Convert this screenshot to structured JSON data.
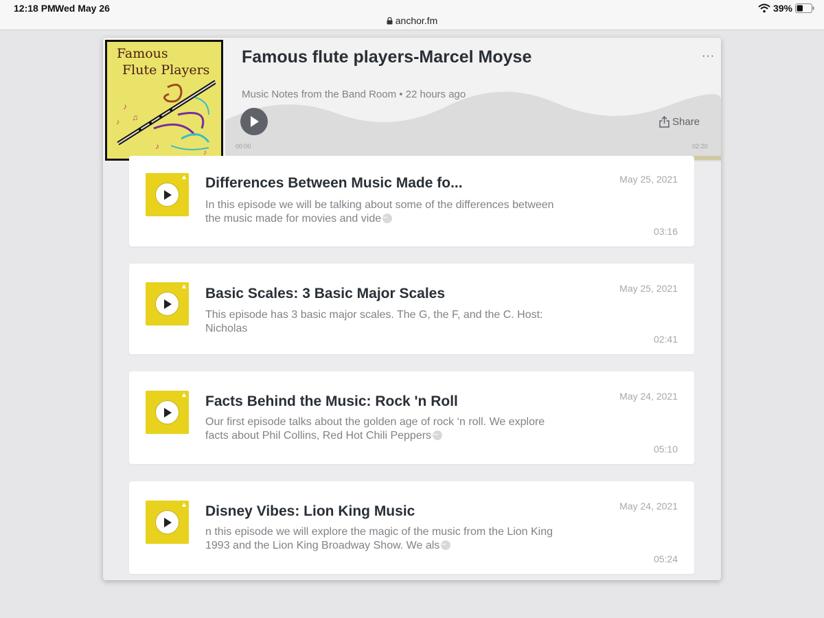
{
  "status": {
    "time": "12:18 PM",
    "date": "Wed May 26",
    "url": "anchor.fm",
    "battery": "39%"
  },
  "player": {
    "cover_line1": "Famous",
    "cover_line2": "Flute Players",
    "title": "Famous flute players-Marcel Moyse",
    "more": "···",
    "podcast_meta": "Music Notes from the Band Room • 22 hours ago",
    "share_label": "Share",
    "time_start": "00:00",
    "time_end": "02:20",
    "progress": 0
  },
  "episodes": [
    {
      "title": "Differences Between Music Made fo...",
      "description": "In this episode we will be talking about some of the differences between the music made for movies and vide",
      "truncated": true,
      "date": "May 25, 2021",
      "duration": "03:16"
    },
    {
      "title": "Basic Scales: 3 Basic Major Scales",
      "description": "This episode has 3 basic major scales. The G, the F, and the C.  Host: Nicholas",
      "truncated": false,
      "date": "May 25, 2021",
      "duration": "02:41"
    },
    {
      "title": "Facts Behind the Music: Rock 'n Roll",
      "description": "Our first episode talks about the golden age of rock ‘n roll. We explore facts about Phil Collins, Red Hot Chili Peppers",
      "truncated": true,
      "date": "May 24, 2021",
      "duration": "05:10"
    },
    {
      "title": "Disney Vibes: Lion King Music",
      "description": "n this episode we will explore the magic of the music from the Lion King 1993 and the Lion King Broadway Show. We als",
      "truncated": true,
      "date": "May 24, 2021",
      "duration": "05:24"
    }
  ],
  "colors": {
    "accent_yellow": "#e8d21d",
    "play_button": "#5f6369",
    "progress_track": "#cfc9a3",
    "page_bg": "#e6e6e8"
  }
}
